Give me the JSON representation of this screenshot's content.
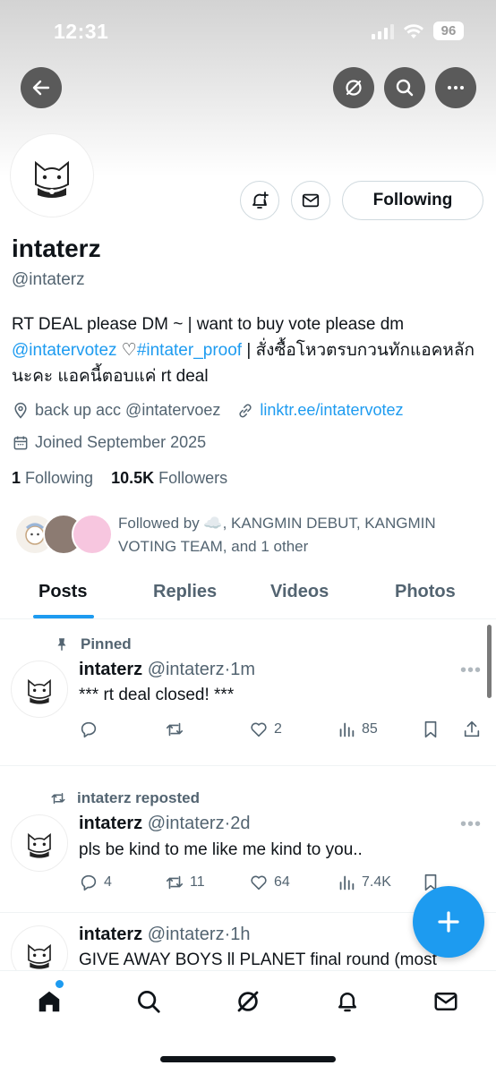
{
  "status_bar": {
    "time": "12:31",
    "battery": "96"
  },
  "profile": {
    "name": "intaterz",
    "handle": "@intaterz",
    "following_button_label": "Following",
    "bio": {
      "part1": "RT DEAL please DM ~ | want to buy vote please dm ",
      "mention": "@intatervotez",
      "heart": " ♡",
      "hashtag": "#intater_proof",
      "part2": " | สั่งซื้อโหวตรบกวนทักแอคหลักนะคะ แอคนี้ตอบแค่ rt deal"
    },
    "location": "back up acc @intatervoez",
    "website": "linktr.ee/intatervotez",
    "joined": "Joined September 2025",
    "following_count": "1",
    "following_label": "Following",
    "followers_count": "10.5K",
    "followers_label": "Followers",
    "followed_by": "Followed by ☁️, KANGMIN DEBUT, KANGMIN VOTING TEAM, and 1 other"
  },
  "tabs": [
    {
      "label": "Posts",
      "active": true
    },
    {
      "label": "Replies",
      "active": false
    },
    {
      "label": "Videos",
      "active": false
    },
    {
      "label": "Photos",
      "active": false
    }
  ],
  "posts": [
    {
      "context": "Pinned",
      "name": "intaterz",
      "handle": "@intaterz",
      "time": "·1m",
      "text": "*** rt deal closed! ***",
      "replies": "",
      "reposts": "",
      "likes": "2",
      "views": "85"
    },
    {
      "context": "intaterz reposted",
      "name": "intaterz",
      "handle": "@intaterz",
      "time": "·2d",
      "text": "pls be kind to me like me kind to you..",
      "replies": "4",
      "reposts": "11",
      "likes": "64",
      "views": "7.4K"
    },
    {
      "context": "",
      "name": "intaterz",
      "handle": "@intaterz",
      "time": "·1h",
      "text": "GIVE AWAY BOYS ll PLANET final round (most",
      "replies": "",
      "reposts": "",
      "likes": "",
      "views": ""
    }
  ],
  "more_glyph": "•••",
  "colors": {
    "accent": "#1d9bf0",
    "text": "#0f1419",
    "secondary": "#536471"
  }
}
